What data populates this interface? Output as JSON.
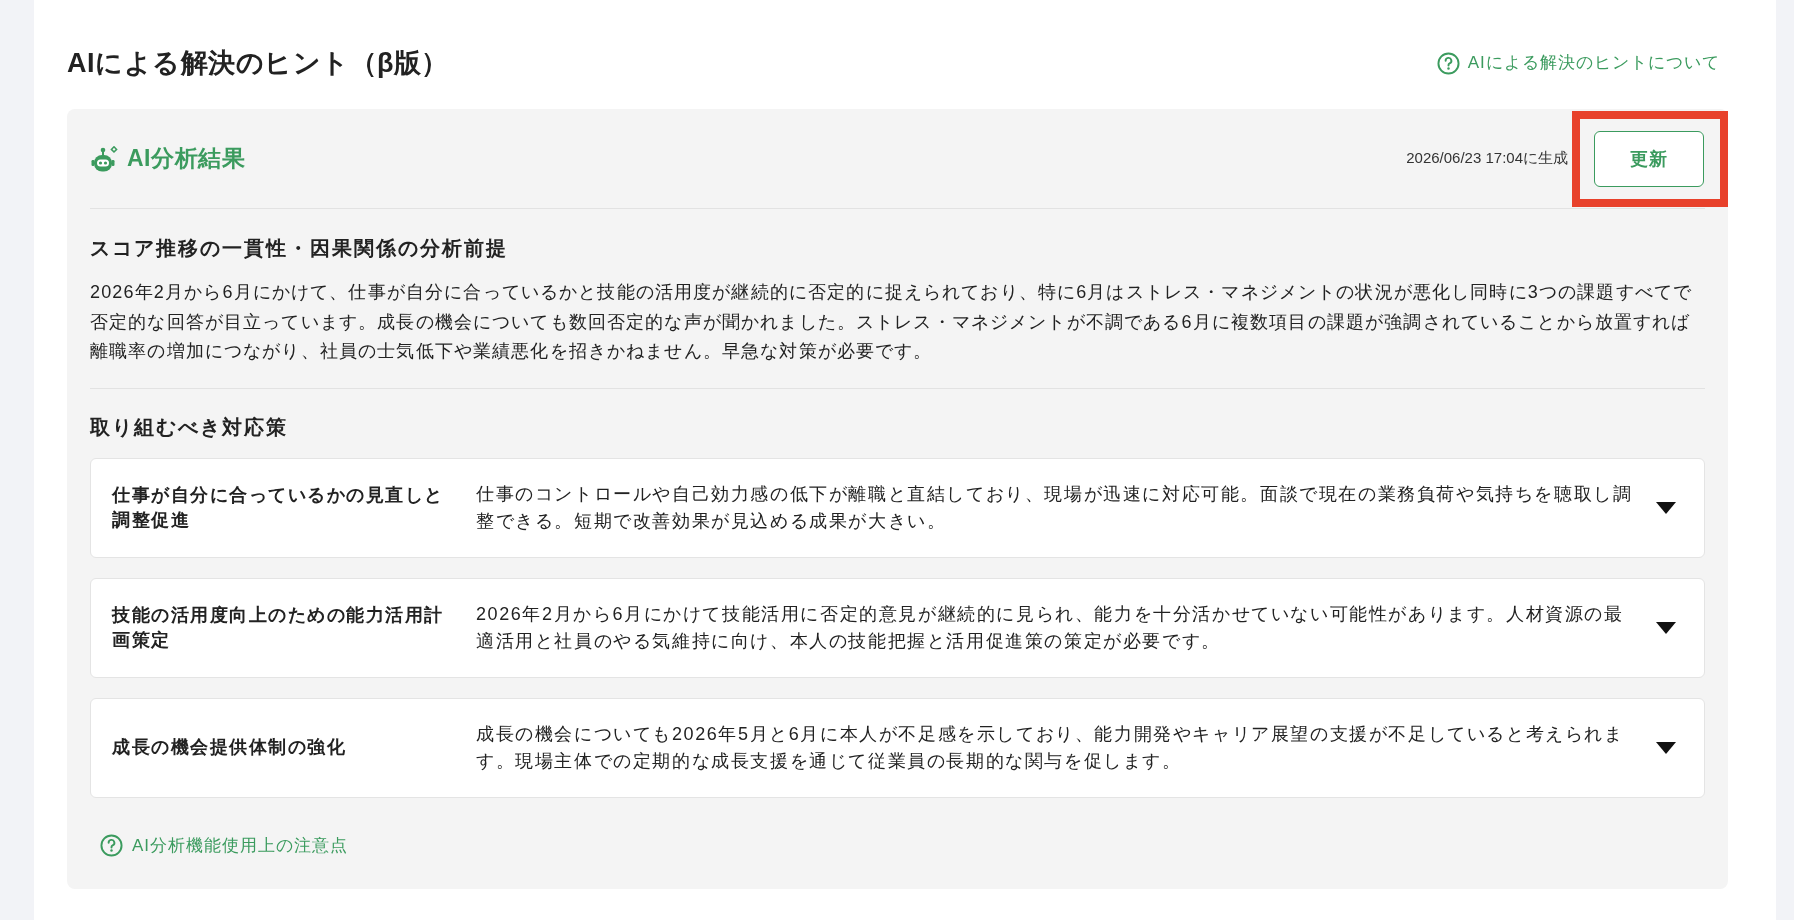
{
  "header": {
    "title": "AIによる解決のヒント（β版）",
    "help_link": "AIによる解決のヒントについて"
  },
  "result_panel": {
    "title": "AI分析結果",
    "generated_at": "2026/06/23 17:04に生成",
    "update_button": {
      "label": "更新",
      "highlighted": true
    },
    "premise": {
      "heading": "スコア推移の一貫性・因果関係の分析前提",
      "body": "2026年2月から6月にかけて、仕事が自分に合っているかと技能の活用度が継続的に否定的に捉えられており、特に6月はストレス・マネジメントの状況が悪化し同時に3つの課題すべてで否定的な回答が目立っています。成長の機会についても数回否定的な声が聞かれました。ストレス・マネジメントが不調である6月に複数項目の課題が強調されていることから放置すれば離職率の増加につながり、社員の士気低下や業績悪化を招きかねません。早急な対策が必要です。"
    },
    "actions": {
      "heading": "取り組むべき対応策",
      "items": [
        {
          "title": "仕事が自分に合っているかの見直しと調整促進",
          "description": "仕事のコントロールや自己効力感の低下が離職と直結しており、現場が迅速に対応可能。面談で現在の業務負荷や気持ちを聴取し調整できる。短期で改善効果が見込める成果が大きい。",
          "expanded": false
        },
        {
          "title": "技能の活用度向上のための能力活用計画策定",
          "description": "2026年2月から6月にかけて技能活用に否定的意見が継続的に見られ、能力を十分活かせていない可能性があります。人材資源の最適活用と社員のやる気維持に向け、本人の技能把握と活用促進策の策定が必要です。",
          "expanded": false
        },
        {
          "title": "成長の機会提供体制の強化",
          "description": "成長の機会についても2026年5月と6月に本人が不足感を示しており、能力開発やキャリア展望の支援が不足していると考えられます。現場主体での定期的な成長支援を通じて従業員の長期的な関与を促します。",
          "expanded": false
        }
      ]
    },
    "notes_link": "AI分析機能使用上の注意点"
  }
}
